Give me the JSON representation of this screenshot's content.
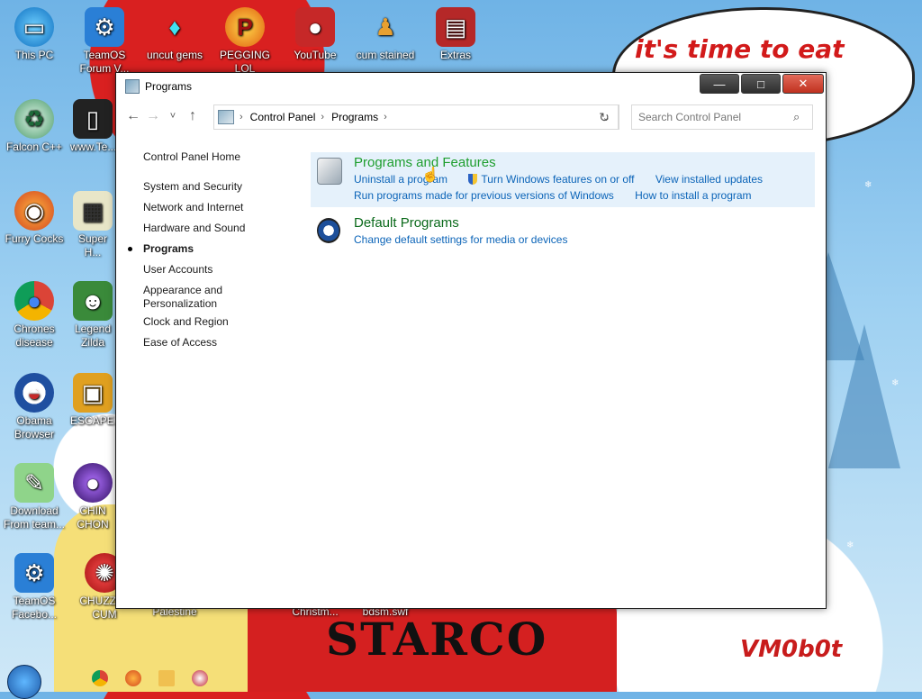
{
  "desktop": {
    "icons": [
      {
        "label": "This PC"
      },
      {
        "label": "TeamOS Forum V..."
      },
      {
        "label": "uncut gems"
      },
      {
        "label": "PEGGING LOL"
      },
      {
        "label": "YouTube"
      },
      {
        "label": "cum stained"
      },
      {
        "label": "Extras"
      },
      {
        "label": "Falcon C++"
      },
      {
        "label": "www.Te..."
      },
      {
        "label": "Furry Cocks"
      },
      {
        "label": "Super H..."
      },
      {
        "label": "Chrones disease"
      },
      {
        "label": "Legend Zilda"
      },
      {
        "label": "Obama Browser"
      },
      {
        "label": "ESCAPE..."
      },
      {
        "label": "Download From team..."
      },
      {
        "label": "CHIN CHON"
      },
      {
        "label": "TeamOS Facebo..."
      },
      {
        "label": "CHUZZLE CUM"
      },
      {
        "label": "Palestine"
      },
      {
        "label": "Christm..."
      },
      {
        "label": "bdsm.swf"
      }
    ],
    "bubble_text": "it's time to eat shit ... ew",
    "shirt_text": "STARCO",
    "signature": "VM0b0t"
  },
  "window": {
    "title": "Programs",
    "controls": {
      "minimize": "—",
      "maximize": "□",
      "close": "✕"
    },
    "nav": {
      "back": "←",
      "forward": "→",
      "recent": "˅",
      "up": "↑"
    },
    "breadcrumb": [
      "Control Panel",
      "Programs"
    ],
    "search_placeholder": "Search Control Panel",
    "sidebar": [
      {
        "label": "Control Panel Home",
        "active": false
      },
      {
        "label": "System and Security",
        "active": false
      },
      {
        "label": "Network and Internet",
        "active": false
      },
      {
        "label": "Hardware and Sound",
        "active": false
      },
      {
        "label": "Programs",
        "active": true
      },
      {
        "label": "User Accounts",
        "active": false
      },
      {
        "label": "Appearance and Personalization",
        "active": false
      },
      {
        "label": "Clock and Region",
        "active": false
      },
      {
        "label": "Ease of Access",
        "active": false
      }
    ],
    "categories": [
      {
        "title": "Programs and Features",
        "links_row1": [
          "Uninstall a program",
          "Turn Windows features on or off",
          "View installed updates"
        ],
        "links_row2": [
          "Run programs made for previous versions of Windows",
          "How to install a program"
        ]
      },
      {
        "title": "Default Programs",
        "links_row1": [
          "Change default settings for media or devices"
        ]
      }
    ]
  },
  "colors": {
    "link": "#0b64b8",
    "category_title": "#1e9e2e",
    "highlight": "#e5f1fb"
  }
}
